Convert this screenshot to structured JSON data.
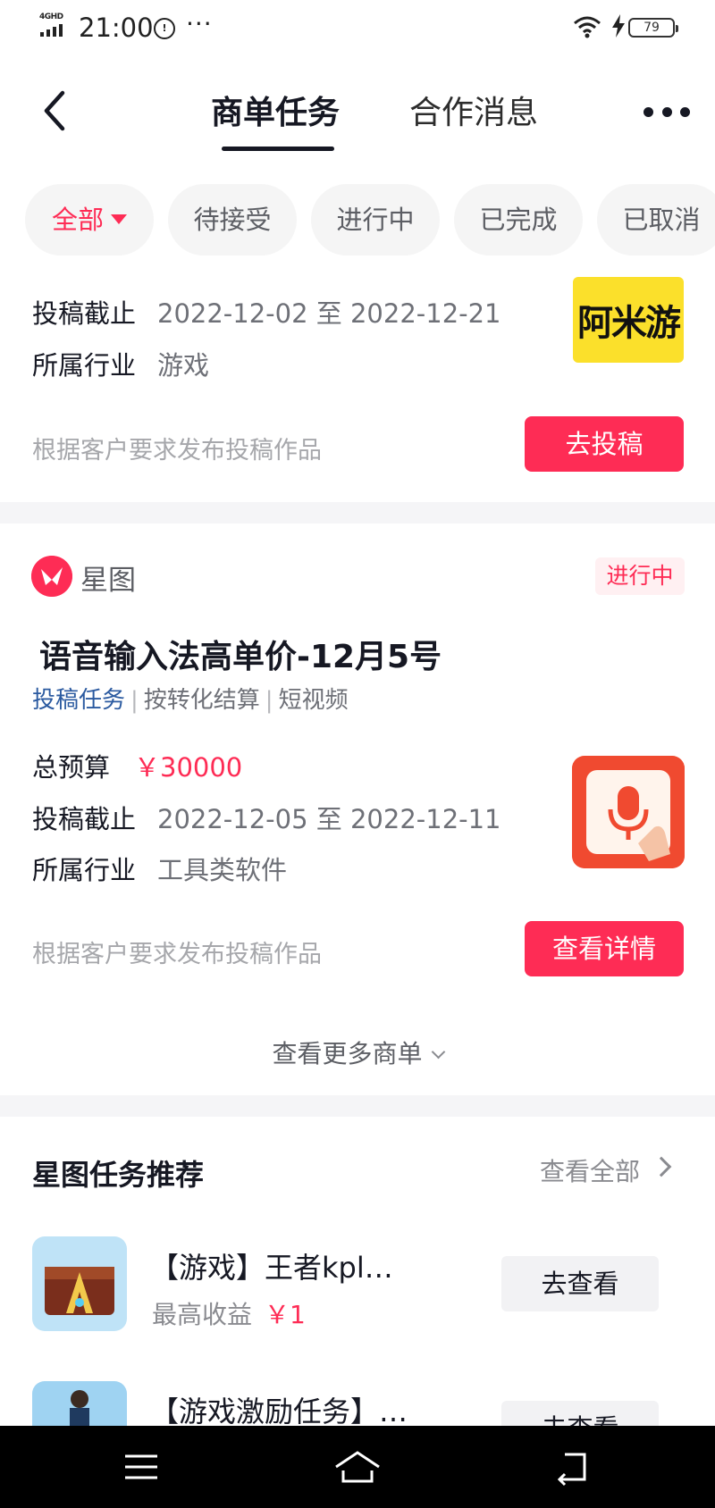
{
  "status_bar": {
    "network": "4GHD",
    "time": "21:00",
    "notification_icon": "circle-notification-icon",
    "more_indicator": "···",
    "battery": "79"
  },
  "header": {
    "tabs": [
      {
        "label": "商单任务",
        "active": true
      },
      {
        "label": "合作消息",
        "active": false
      }
    ]
  },
  "filters": [
    {
      "label": "全部",
      "active": true
    },
    {
      "label": "待接受",
      "active": false
    },
    {
      "label": "进行中",
      "active": false
    },
    {
      "label": "已完成",
      "active": false
    },
    {
      "label": "已取消",
      "active": false
    }
  ],
  "card1": {
    "deadline_label": "投稿截止",
    "deadline_value": "2022-12-02 至 2022-12-21",
    "industry_label": "所属行业",
    "industry_value": "游戏",
    "logo_text": "阿米游",
    "hint": "根据客户要求发布投稿作品",
    "button": "去投稿"
  },
  "card2": {
    "brand": "星图",
    "status": "进行中",
    "title": "语音输入法高单价-12月5号",
    "tags": [
      "投稿任务",
      "按转化结算",
      "短视频"
    ],
    "budget_label": "总预算",
    "budget_value": "￥30000",
    "deadline_label": "投稿截止",
    "deadline_value": "2022-12-05 至 2022-12-11",
    "industry_label": "所属行业",
    "industry_value": "工具类软件",
    "hint": "根据客户要求发布投稿作品",
    "button": "查看详情"
  },
  "more_orders": "查看更多商单",
  "recommend": {
    "title": "星图任务推荐",
    "view_all": "查看全部",
    "items": [
      {
        "name": "【游戏】王者kpl…",
        "sub_label": "最高收益",
        "sub_value": "￥1",
        "button": "去查看"
      },
      {
        "name": "【游戏激励任务】…",
        "button": "去查看"
      }
    ]
  },
  "colors": {
    "accent": "#fe2c55",
    "tag_blue": "#2b5aa0",
    "logo_yellow": "#fbe02b"
  }
}
